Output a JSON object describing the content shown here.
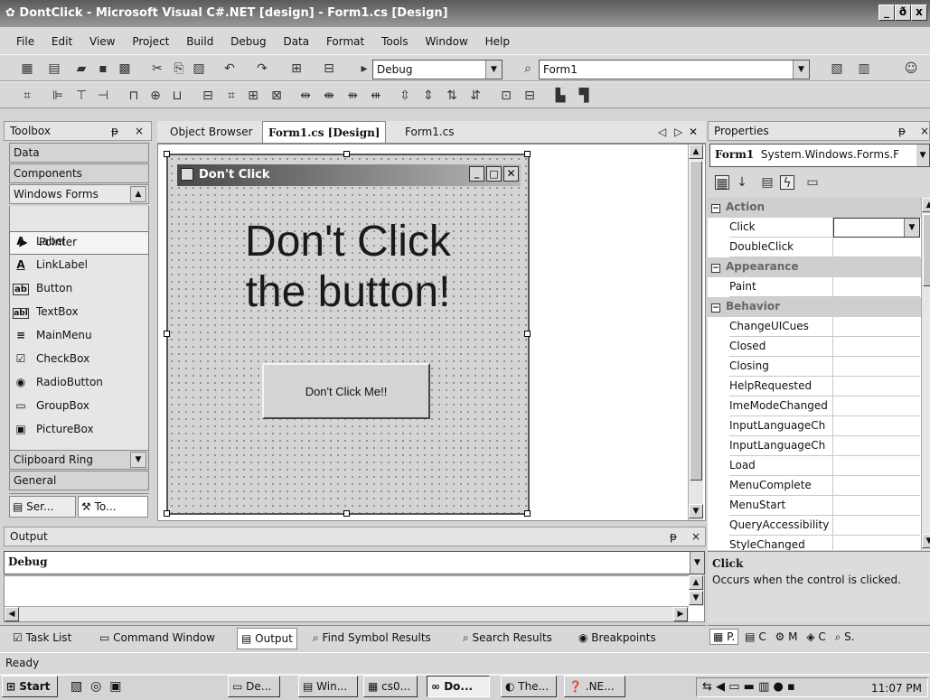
{
  "window": {
    "title": "DontClick - Microsoft Visual C#.NET [design] - Form1.cs [Design]",
    "min": "_",
    "max": "ð",
    "close": "x"
  },
  "menu": [
    "File",
    "Edit",
    "View",
    "Project",
    "Build",
    "Debug",
    "Data",
    "Format",
    "Tools",
    "Window",
    "Help"
  ],
  "toolbar": {
    "config": "Debug",
    "project": "Form1"
  },
  "toolbox": {
    "title": "Toolbox",
    "pin": "ᵽ",
    "close": "×",
    "categories_top": [
      "Data",
      "Components",
      "Windows Forms"
    ],
    "items": [
      {
        "label": "Pointer",
        "icon": "▶"
      },
      {
        "label": "Label",
        "icon": "A"
      },
      {
        "label": "LinkLabel",
        "icon": "A"
      },
      {
        "label": "Button",
        "icon": "ab"
      },
      {
        "label": "TextBox",
        "icon": "abl"
      },
      {
        "label": "MainMenu",
        "icon": "≡"
      },
      {
        "label": "CheckBox",
        "icon": "☑"
      },
      {
        "label": "RadioButton",
        "icon": "◉"
      },
      {
        "label": "GroupBox",
        "icon": "▭"
      },
      {
        "label": "PictureBox",
        "icon": "▣"
      }
    ],
    "categories_bottom": [
      "Clipboard Ring",
      "General"
    ],
    "bottom_tabs": [
      "Ser...",
      "To..."
    ]
  },
  "editor_tabs": [
    "Object Browser",
    "Form1.cs [Design]",
    "Form1.cs"
  ],
  "form": {
    "title": "Don't Click",
    "line1": "Don't Click",
    "line2": "the button!",
    "button": "Don't Click Me!!"
  },
  "properties": {
    "title": "Properties",
    "object": "Form1",
    "object_type": "System.Windows.Forms.F",
    "cat_action": "Action",
    "cat_appearance": "Appearance",
    "cat_behavior": "Behavior",
    "action_events": [
      "Click",
      "DoubleClick"
    ],
    "appearance_events": [
      "Paint"
    ],
    "behavior_events": [
      "ChangeUICues",
      "Closed",
      "Closing",
      "HelpRequested",
      "ImeModeChanged",
      "InputLanguageCh",
      "InputLanguageCh",
      "Load",
      "MenuComplete",
      "MenuStart",
      "QueryAccessibility",
      "StyleChanged"
    ],
    "desc_title": "Click",
    "desc_text": "Occurs when the control is clicked.",
    "bottom_tabs": [
      "P.",
      "C",
      "M",
      "C",
      "S."
    ]
  },
  "output": {
    "title": "Output",
    "pane": "Debug"
  },
  "bottom_tabs": [
    "Task List",
    "Command Window",
    "Output",
    "Find Symbol Results",
    "Search Results",
    "Breakpoints"
  ],
  "status": "Ready",
  "taskbar": {
    "start": "Start",
    "buttons": [
      "De...",
      "Win...",
      "cs0...",
      "Do...",
      "The...",
      ".NE..."
    ],
    "clock": "11:07 PM"
  }
}
